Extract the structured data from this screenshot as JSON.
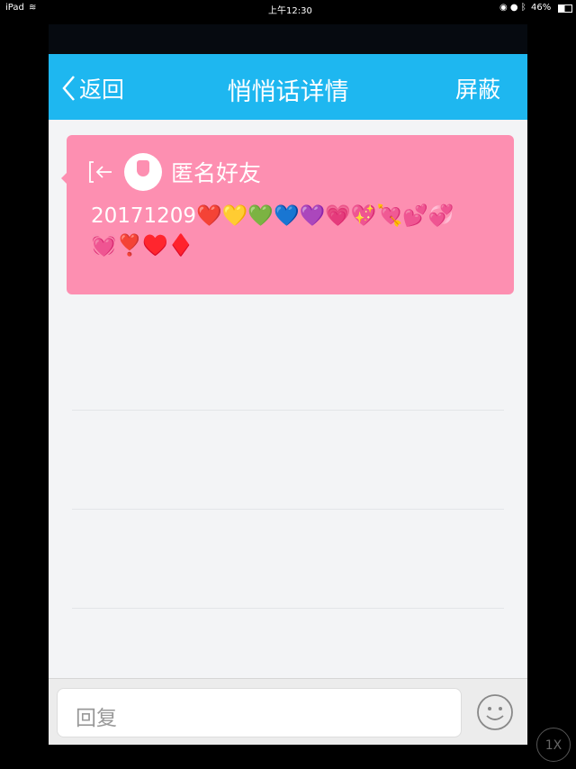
{
  "status": {
    "device": "iPad",
    "time": "上午12:30",
    "battery": "46%"
  },
  "nav": {
    "back": "返回",
    "title": "悄悄话详情",
    "block": "屏蔽"
  },
  "message": {
    "sender": "匿名好友",
    "text": "20171209❤️💛💚💙💜💗💖💘💕💞💓❣️♥️♦️"
  },
  "reply": {
    "placeholder": "回复"
  },
  "zoom_badge": "1X"
}
